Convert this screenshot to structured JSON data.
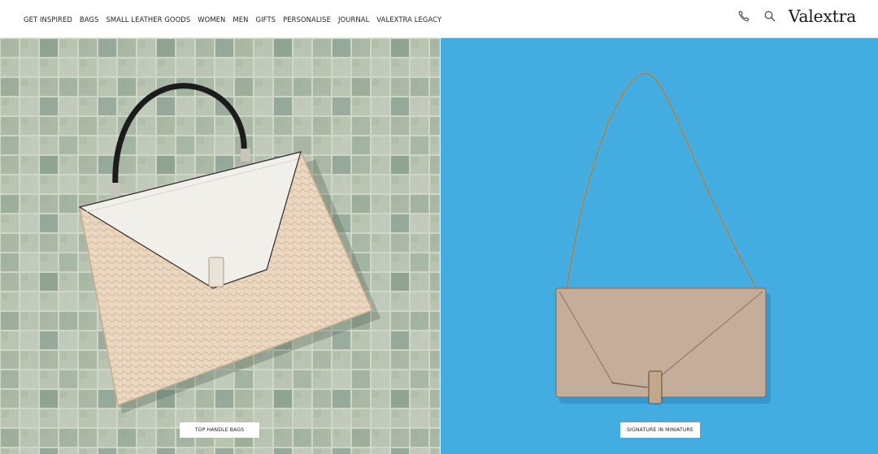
{
  "brand": {
    "name": "Valextra"
  },
  "nav": {
    "items": [
      {
        "label": "GET INSPIRED"
      },
      {
        "label": "BAGS"
      },
      {
        "label": "SMALL LEATHER GOODS"
      },
      {
        "label": "WOMEN"
      },
      {
        "label": "MEN"
      },
      {
        "label": "GIFTS"
      },
      {
        "label": "PERSONALISE"
      },
      {
        "label": "JOURNAL"
      },
      {
        "label": "VALEXTRA LEGACY"
      }
    ]
  },
  "header_icons": {
    "phone": "phone-icon",
    "search": "search-icon"
  },
  "panels": {
    "left": {
      "cta_label": "TOP HANDLE BAGS",
      "background": "#a9b6a2"
    },
    "right": {
      "cta_label": "SIGNATURE IN MINIATURE",
      "background": "#3aa6dd"
    }
  }
}
